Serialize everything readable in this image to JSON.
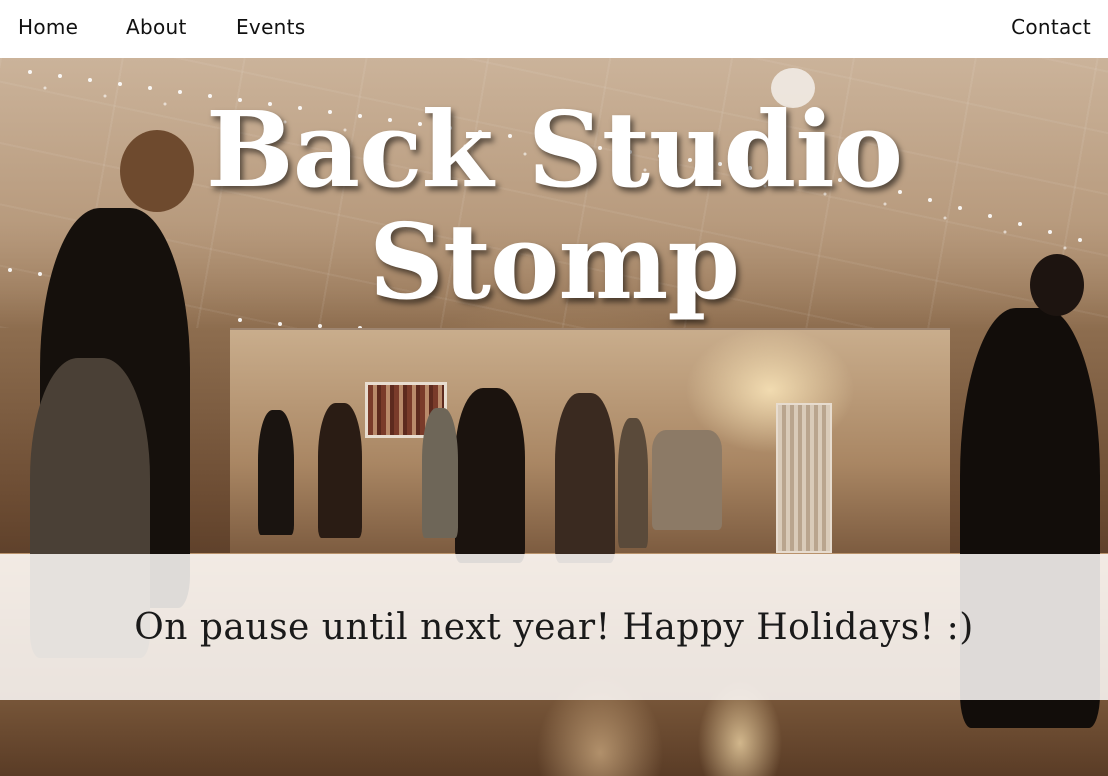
{
  "nav": {
    "home": "Home",
    "about": "About",
    "events": "Events",
    "contact": "Contact"
  },
  "hero": {
    "title_line1": "Back Studio",
    "title_line2": "Stomp",
    "banner_text": "On pause until next year! Happy Holidays! :)"
  },
  "colors": {
    "nav_background": "#ffffff",
    "nav_text": "#111111",
    "title_text": "#ffffff",
    "banner_background": "#faf7f5",
    "banner_text": "#1a1a1a"
  }
}
